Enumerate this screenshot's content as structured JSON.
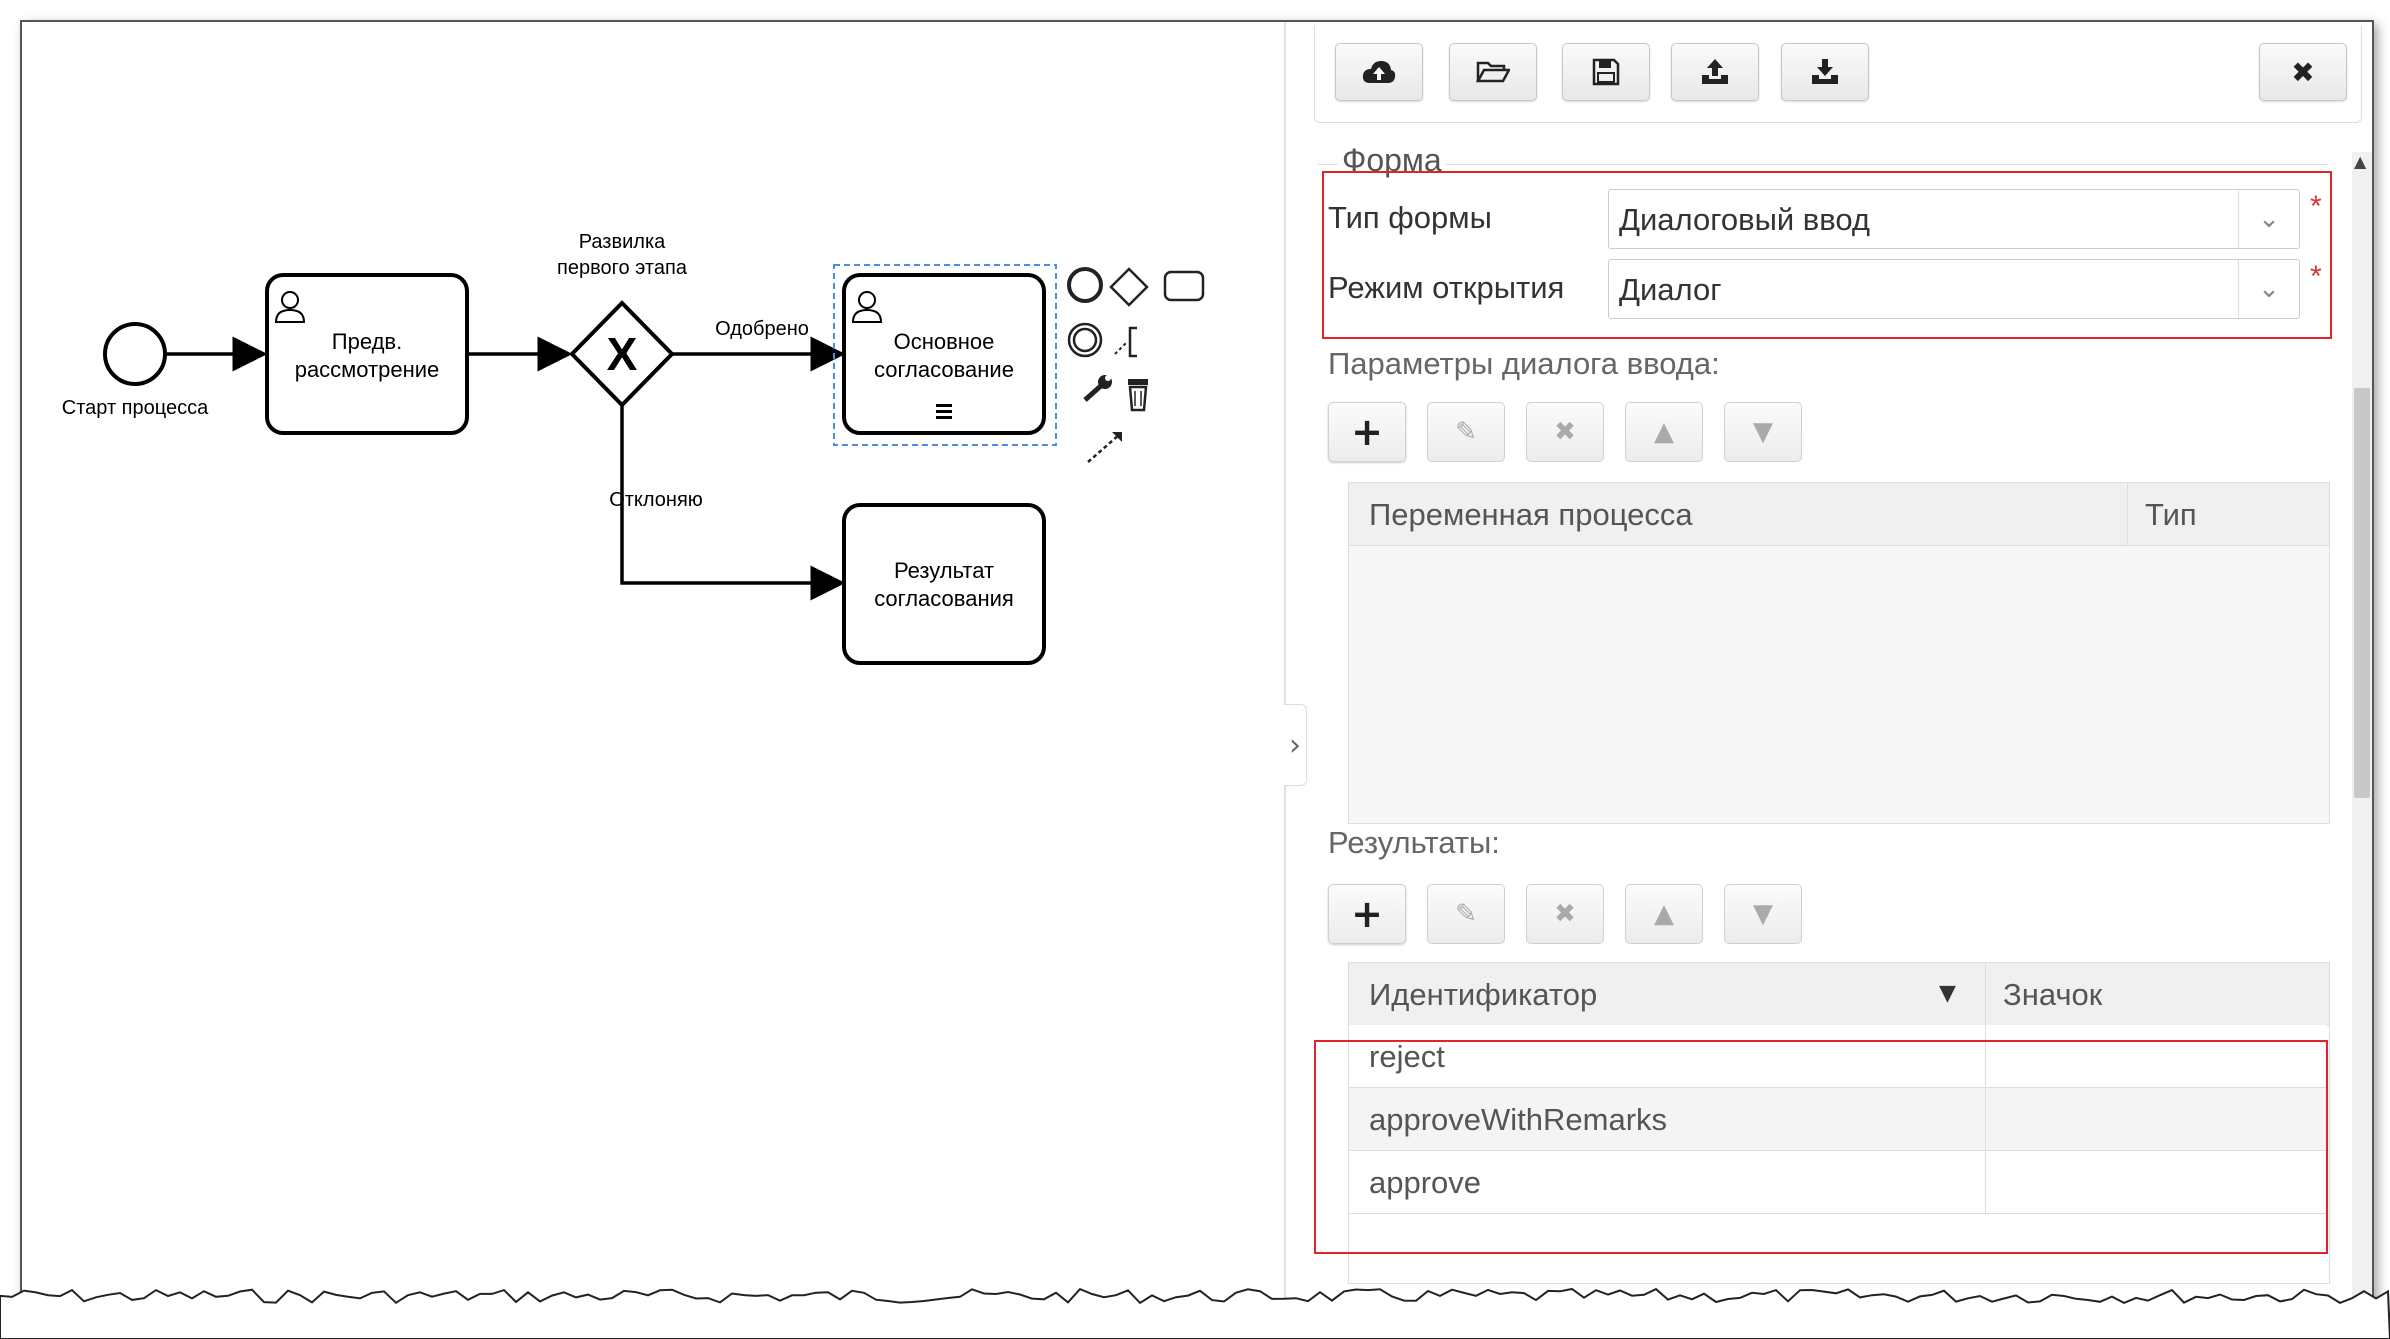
{
  "diagram": {
    "start_event_label": "Старт процесса",
    "task1_label_l1": "Предв.",
    "task1_label_l2": "рассмотрение",
    "gateway_label_l1": "Развилка",
    "gateway_label_l2": "первого этапа",
    "gateway_symbol": "X",
    "flow_approved_label": "Одобрено",
    "flow_rejected_label": "Отклоняю",
    "task2_label_l1": "Основное",
    "task2_label_l2": "согласование",
    "task3_label_l1": "Результат",
    "task3_label_l2": "согласования"
  },
  "toolbar": {
    "icons": [
      "cloud-upload-icon",
      "folder-open-icon",
      "save-icon",
      "upload-icon",
      "download-icon",
      "close-icon"
    ]
  },
  "form": {
    "legend": "Форма",
    "type_label": "Тип формы",
    "type_value": "Диалоговый ввод",
    "mode_label": "Режим открытия",
    "mode_value": "Диалог",
    "required_mark": "*",
    "params_label": "Параметры диалога ввода:",
    "params_columns": [
      "Переменная процесса",
      "Тип"
    ],
    "results_label": "Результаты:",
    "results_columns": [
      "Идентификатор",
      "Значок"
    ],
    "results_rows": [
      {
        "id": "reject",
        "icon": ""
      },
      {
        "id": "approveWithRemarks",
        "icon": ""
      },
      {
        "id": "approve",
        "icon": ""
      }
    ]
  },
  "colors": {
    "highlight_red": "#e0242b",
    "selection_blue": "#4a90e2"
  }
}
